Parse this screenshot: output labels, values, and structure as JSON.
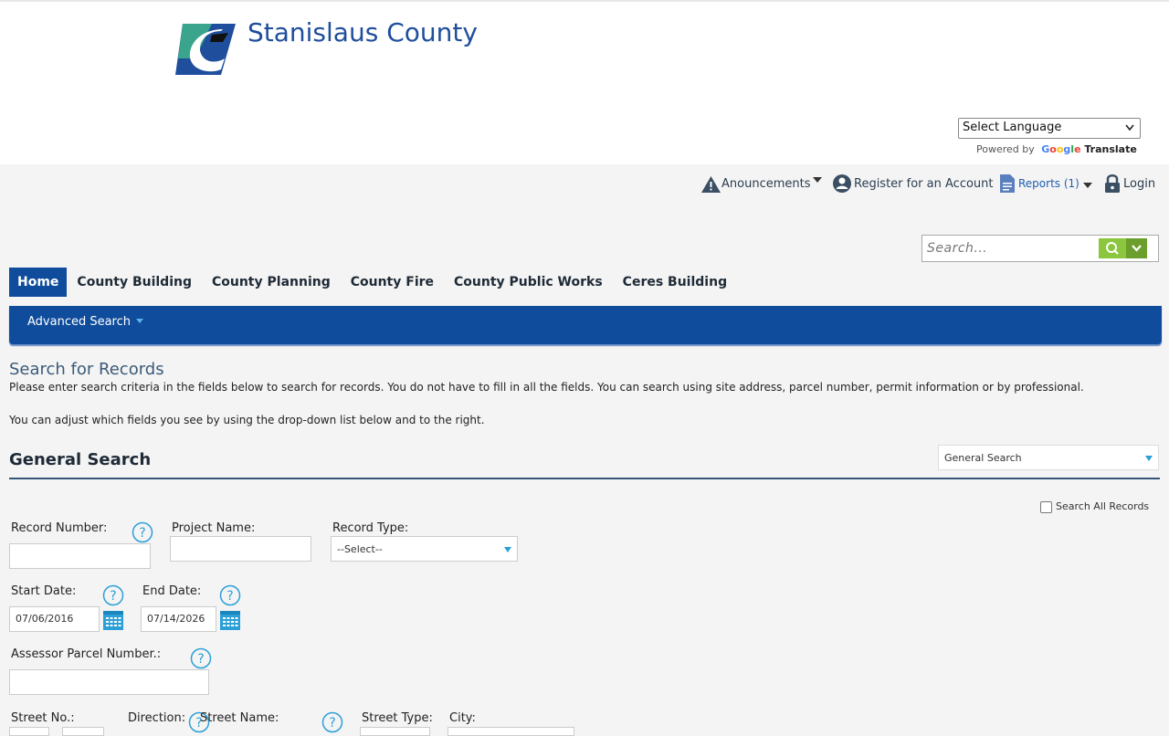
{
  "header": {
    "county_name": "Stanislaus County",
    "logo_icon": "stanislaus-county-logo",
    "language_select": "Select Language",
    "powered_by": "Powered by",
    "google": "Google",
    "translate": "Translate"
  },
  "utility_nav": {
    "announcements": "Anouncements",
    "register": "Register for an Account",
    "reports": "Reports (1)",
    "login": "Login"
  },
  "search": {
    "placeholder": "Search..."
  },
  "tabs": [
    "Home",
    "County Building",
    "County Planning",
    "County Fire",
    "County Public Works",
    "Ceres Building"
  ],
  "subnav": {
    "advanced_search": "Advanced Search"
  },
  "page": {
    "title": "Search for Records",
    "intro1": "Please enter search criteria in the fields below to search for records.  You do not have to fill in all the fields.  You can search using site address, parcel number, permit information or by professional.",
    "intro2": "You can adjust which fields you see by using the drop-down list below and to the right.",
    "section_title": "General Search",
    "section_select": "General Search",
    "search_all_records": "Search All Records"
  },
  "form": {
    "record_number": {
      "label": "Record Number:",
      "value": ""
    },
    "project_name": {
      "label": "Project Name:",
      "value": ""
    },
    "record_type": {
      "label": "Record Type:",
      "value": "--Select--"
    },
    "start_date": {
      "label": "Start Date:",
      "value": "07/06/2016"
    },
    "end_date": {
      "label": "End Date:",
      "value": "07/14/2026"
    },
    "apn": {
      "label": "Assessor Parcel Number.:",
      "value": ""
    },
    "street_no": {
      "label": "Street No.:"
    },
    "direction": {
      "label": "Direction:"
    },
    "street_name": {
      "label": "Street Name:"
    },
    "street_type": {
      "label": "Street Type:"
    },
    "city": {
      "label": "City:"
    }
  },
  "colors": {
    "brand_blue": "#0f4c9c",
    "title_blue": "#1f4e9c",
    "search_green": "#8cc63f",
    "help_blue": "#2a9fd8"
  }
}
